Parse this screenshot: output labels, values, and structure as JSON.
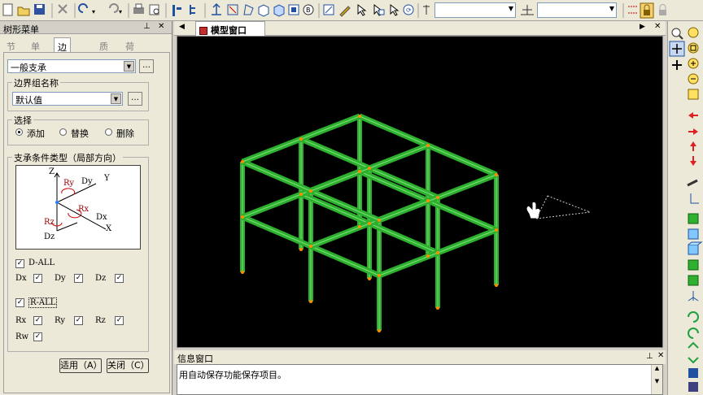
{
  "left_panel": {
    "title": "树形菜单",
    "tabs": [
      "节点",
      "单元",
      "边界条件",
      "质量",
      "荷载"
    ],
    "support_type": "一般支承",
    "group_label": "边界组名称",
    "group_value": "默认值",
    "select_label": "选择",
    "options": [
      "添加",
      "替换",
      "删除"
    ],
    "support_cond_label": "支承条件类型（局部方向）",
    "diagram_labels": {
      "z": "Z",
      "y": "Y",
      "x": "X",
      "ry": "Ry",
      "dy": "Dy",
      "rx": "Rx",
      "dx": "Dx",
      "rz": "Rz",
      "dz": "Dz"
    },
    "d_all": "D-ALL",
    "r_all": "R-ALL",
    "d_items": [
      "Dx",
      "Dy",
      "Dz"
    ],
    "r_items": [
      "Rx",
      "Ry",
      "Rz",
      "Rw"
    ],
    "apply_button": "适用（A）",
    "close_button": "关闭（C）"
  },
  "model_window": {
    "tab_title": "模型窗口"
  },
  "info_window": {
    "title": "信息窗口",
    "message": "用自动保存功能保存项目。"
  },
  "colors": {
    "frame_green": "#2db02d",
    "node_orange": "#ff8c00",
    "background_black": "#000000"
  }
}
